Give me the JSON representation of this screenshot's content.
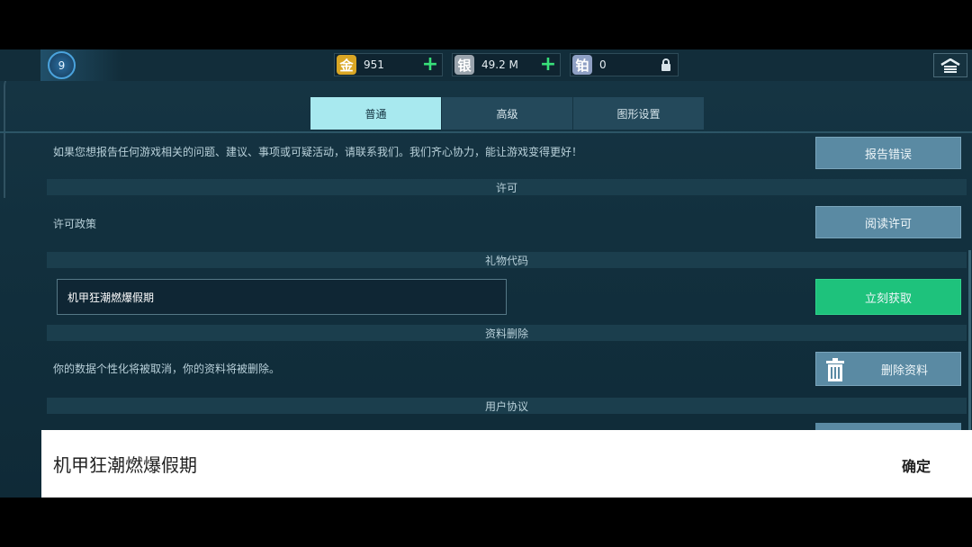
{
  "player": {
    "level": "9"
  },
  "currencies": [
    {
      "icon_char": "金",
      "value": "951",
      "color": "#d9a624"
    },
    {
      "icon_char": "银",
      "value": "49.2 M",
      "color": "#9aa4ad"
    },
    {
      "icon_char": "铂",
      "value": "0",
      "color": "#8fa0c4"
    }
  ],
  "tabs": [
    {
      "label": "普通",
      "active": true
    },
    {
      "label": "高级",
      "active": false
    },
    {
      "label": "图形设置",
      "active": false
    }
  ],
  "settings": {
    "report_text": "如果您想报告任何游戏相关的问题、建议、事项或可疑活动，请联系我们。我们齐心协力，能让游戏变得更好！",
    "report_button": "报告错误",
    "license_header": "许可",
    "license_text": "许可政策",
    "license_button": "阅读许可",
    "gift_header": "礼物代码",
    "gift_input_value": "机甲狂潮燃爆假期",
    "gift_button": "立刻获取",
    "delete_header": "资料删除",
    "delete_text": "你的数据个性化将被取消，你的资料将被删除。",
    "delete_button": "删除资料",
    "agreement_header": "用户协议"
  },
  "ime": {
    "text": "机甲狂潮燃爆假期",
    "confirm": "确定"
  },
  "colors": {
    "accent_tab": "#a8e9ef",
    "button": "#5a8aa3",
    "confirm_green": "#1ec27c",
    "plus_green": "#38e07a"
  }
}
